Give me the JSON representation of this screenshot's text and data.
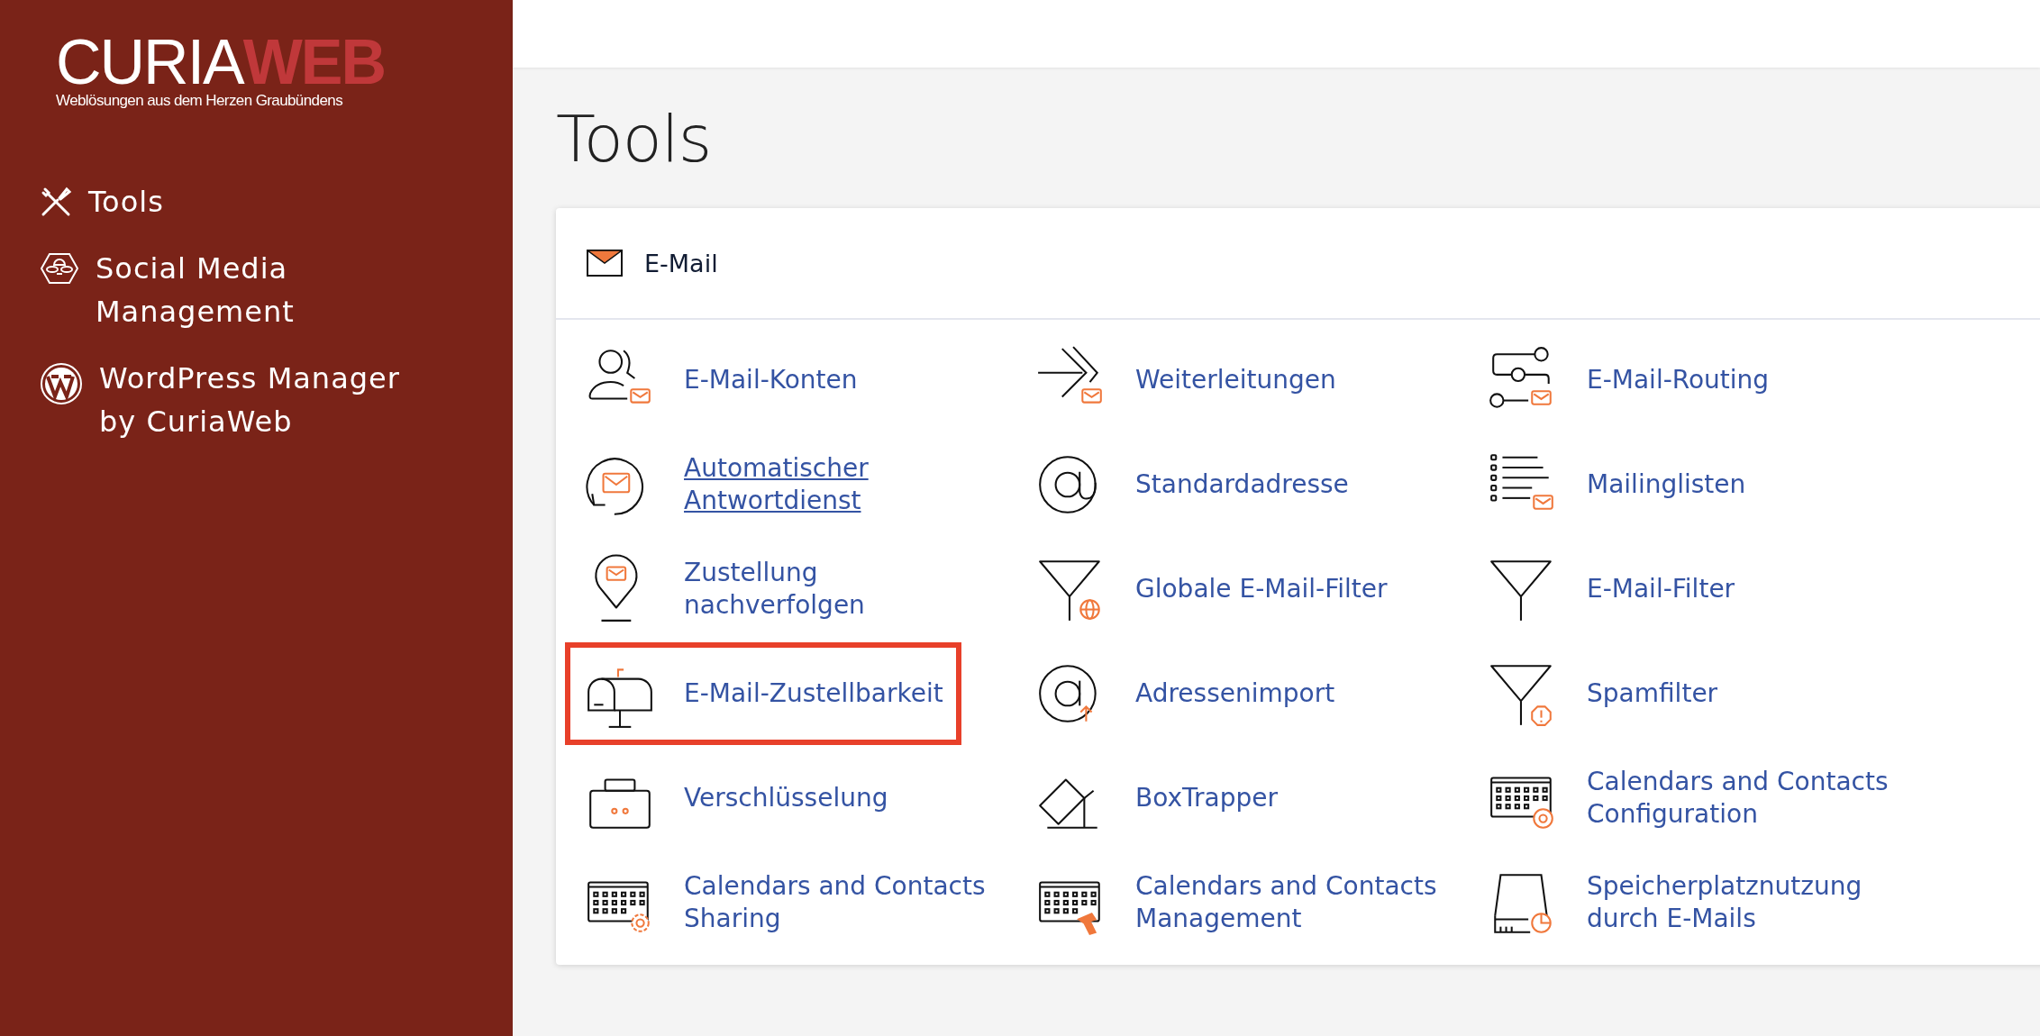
{
  "logo": {
    "name_white": "CURIA",
    "name_red": "WEB",
    "tagline": "Weblösungen aus dem Herzen Graubündens"
  },
  "sidebar": {
    "items": [
      {
        "label": "Tools"
      },
      {
        "label": "Social Media Management"
      },
      {
        "label": "WordPress Manager by CuriaWeb"
      }
    ]
  },
  "page_title": "Tools",
  "section": {
    "title": "E-Mail",
    "items": [
      {
        "label": "E-Mail-Konten",
        "underlined": false,
        "highlighted": false
      },
      {
        "label": "Weiterleitungen",
        "underlined": false,
        "highlighted": false
      },
      {
        "label": "E-Mail-Routing",
        "underlined": false,
        "highlighted": false
      },
      {
        "label": "Automatischer Antwortdienst",
        "underlined": true,
        "highlighted": false
      },
      {
        "label": "Standardadresse",
        "underlined": false,
        "highlighted": false
      },
      {
        "label": "Mailinglisten",
        "underlined": false,
        "highlighted": false
      },
      {
        "label": "Zustellung nachverfolgen",
        "underlined": false,
        "highlighted": false
      },
      {
        "label": "Globale E-Mail-Filter",
        "underlined": false,
        "highlighted": false
      },
      {
        "label": "E-Mail-Filter",
        "underlined": false,
        "highlighted": false
      },
      {
        "label": "E-Mail-Zustellbarkeit",
        "underlined": false,
        "highlighted": true
      },
      {
        "label": "Adressenimport",
        "underlined": false,
        "highlighted": false
      },
      {
        "label": "Spamfilter",
        "underlined": false,
        "highlighted": false
      },
      {
        "label": "Verschlüsselung",
        "underlined": false,
        "highlighted": false
      },
      {
        "label": "BoxTrapper",
        "underlined": false,
        "highlighted": false
      },
      {
        "label": "Calendars and Contacts Configuration",
        "underlined": false,
        "highlighted": false
      },
      {
        "label": "Calendars and Contacts Sharing",
        "underlined": false,
        "highlighted": false
      },
      {
        "label": "Calendars and Contacts Management",
        "underlined": false,
        "highlighted": false
      },
      {
        "label": "Speicherplatznutzung durch E-Mails",
        "underlined": false,
        "highlighted": false
      }
    ]
  }
}
